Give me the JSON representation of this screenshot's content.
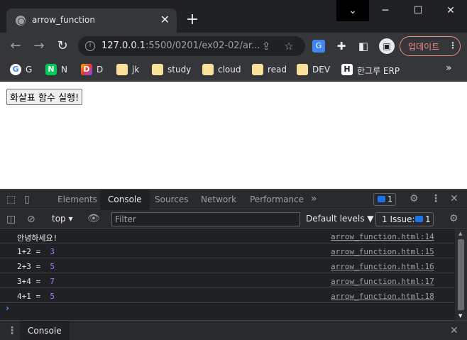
{
  "browser": {
    "tab_title": "arrow_function",
    "url_host": "127.0.0.1",
    "url_path": ":5500/0201/ex02-02/ar...",
    "update_label": "업데이트",
    "bookmarks": [
      {
        "label": "G",
        "icon": "google-icon",
        "color": "#4285f4"
      },
      {
        "label": "N",
        "icon": "naver-icon",
        "color": "#03c75a"
      },
      {
        "label": "D",
        "icon": "d-icon",
        "color": "#7c4dff"
      },
      {
        "label": "jk",
        "icon": "folder-icon"
      },
      {
        "label": "study",
        "icon": "folder-icon"
      },
      {
        "label": "cloud",
        "icon": "folder-icon"
      },
      {
        "label": "read",
        "icon": "folder-icon"
      },
      {
        "label": "DEV",
        "icon": "folder-icon"
      },
      {
        "label": "한그루 ERP",
        "icon": "h-icon"
      }
    ],
    "more_bookmarks": "»"
  },
  "page": {
    "run_button": "화살표 함수 실행!"
  },
  "devtools": {
    "tabs": [
      "Elements",
      "Console",
      "Sources",
      "Network",
      "Performance"
    ],
    "active_tab": "Console",
    "more_tabs": "»",
    "issue_count": "1",
    "context": "top",
    "filter_placeholder": "Filter",
    "levels": "Default levels ▼",
    "issues_label": "1 Issue:",
    "issues_count": "1",
    "logs": [
      {
        "text": "안녕하세요!",
        "value": "",
        "source": "arrow_function.html:14"
      },
      {
        "text": "1+2 =  ",
        "value": "3",
        "source": "arrow_function.html:15"
      },
      {
        "text": "2+3 =  ",
        "value": "5",
        "source": "arrow_function.html:16"
      },
      {
        "text": "3+4 =  ",
        "value": "7",
        "source": "arrow_function.html:17"
      },
      {
        "text": "4+1 =  ",
        "value": "5",
        "source": "arrow_function.html:18"
      }
    ],
    "prompt": "›",
    "drawer_tab": "Console"
  }
}
